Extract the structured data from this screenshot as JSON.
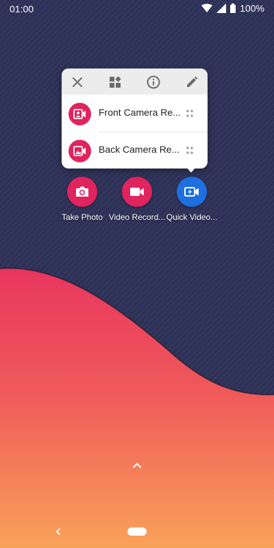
{
  "status_bar": {
    "time": "01:00",
    "battery": "100%",
    "icons": [
      "wifi-icon",
      "signal-icon",
      "battery-icon"
    ]
  },
  "popup": {
    "toolbar": [
      "close-icon",
      "widgets-icon",
      "info-icon",
      "edit-icon"
    ],
    "shortcuts": [
      {
        "label": "Front Camera Re...",
        "icon": "front-camera-video-icon"
      },
      {
        "label": "Back Camera Re...",
        "icon": "back-camera-video-icon"
      }
    ]
  },
  "apps": [
    {
      "name": "Take Photo",
      "icon": "camera-icon",
      "color": "#e0245e"
    },
    {
      "name": "Video Record...",
      "icon": "video-camera-icon",
      "color": "#e0245e"
    },
    {
      "name": "Quick Video...",
      "icon": "quick-video-icon",
      "color": "#1e6fe0"
    }
  ],
  "colors": {
    "wallpaper_top": "#2e3156",
    "wave_top": "#e8365e",
    "wave_bottom": "#f9a25a",
    "accent_red": "#e0245e",
    "accent_blue": "#1e6fe0"
  }
}
